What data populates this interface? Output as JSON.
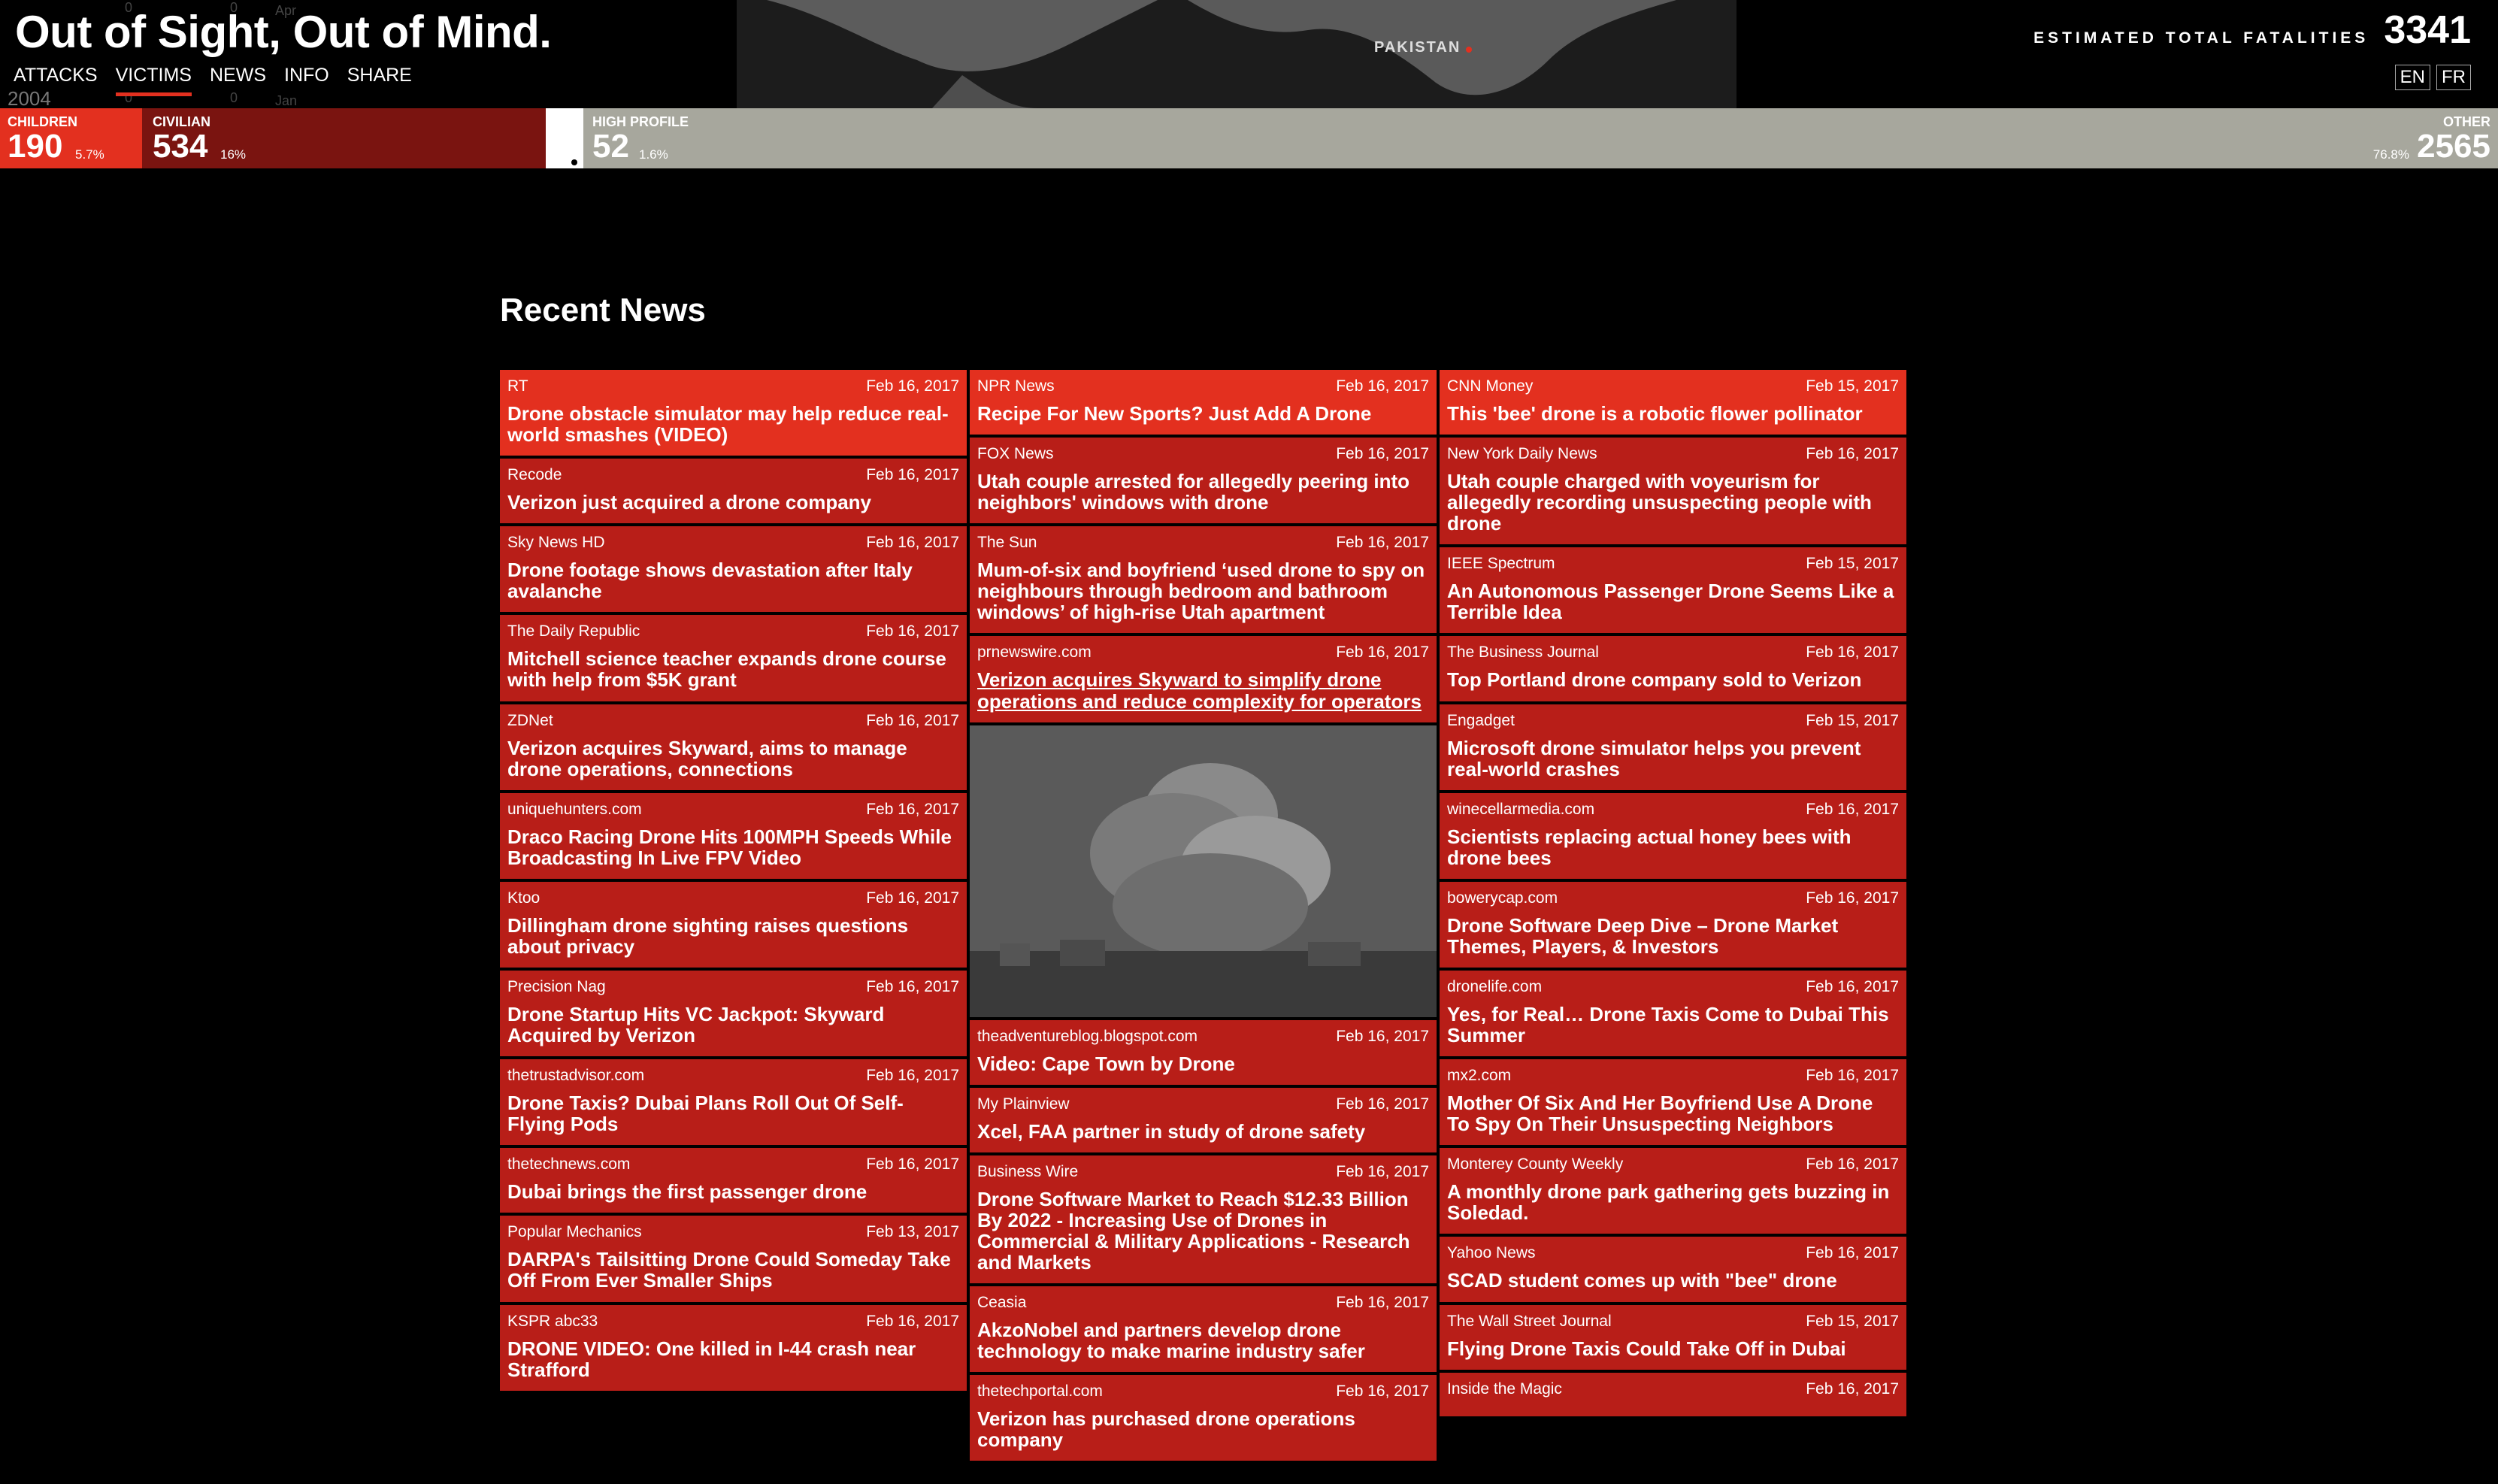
{
  "header": {
    "title": "Out of Sight, Out of Mind.",
    "nav": [
      "ATTACKS",
      "VICTIMS",
      "NEWS",
      "INFO",
      "SHARE"
    ],
    "active_nav": "VICTIMS",
    "map_label": "PAKISTAN",
    "fatalities_label": "ESTIMATED TOTAL FATALITIES",
    "fatalities_value": "3341",
    "languages": [
      "EN",
      "FR"
    ],
    "timeline_year": "2004",
    "timeline_ghost": [
      "0",
      "0",
      "Apr",
      "0",
      "0",
      "Jan"
    ]
  },
  "victims": {
    "children": {
      "label": "CHILDREN",
      "value": "190",
      "pct": "5.7%"
    },
    "civilian": {
      "label": "CIVILIAN",
      "value": "534",
      "pct": "16%"
    },
    "high_profile": {
      "label": "HIGH PROFILE",
      "value": "52",
      "pct": "1.6%"
    },
    "other": {
      "label": "OTHER",
      "value": "2565",
      "pct": "76.8%"
    }
  },
  "news": {
    "title": "Recent News",
    "columns": [
      [
        {
          "source": "RT",
          "date": "Feb 16, 2017",
          "title": "Drone obstacle simulator may help reduce real-world smashes (VIDEO)"
        },
        {
          "source": "Recode",
          "date": "Feb 16, 2017",
          "title": "Verizon just acquired a drone company"
        },
        {
          "source": "Sky News HD",
          "date": "Feb 16, 2017",
          "title": "Drone footage shows devastation after Italy avalanche"
        },
        {
          "source": "The Daily Republic",
          "date": "Feb 16, 2017",
          "title": "Mitchell science teacher expands drone course with help from $5K grant"
        },
        {
          "source": "ZDNet",
          "date": "Feb 16, 2017",
          "title": "Verizon acquires Skyward, aims to manage drone operations, connections"
        },
        {
          "source": "uniquehunters.com",
          "date": "Feb 16, 2017",
          "title": "Draco Racing Drone Hits 100MPH Speeds While Broadcasting In Live FPV Video"
        },
        {
          "source": "Ktoo",
          "date": "Feb 16, 2017",
          "title": "Dillingham drone sighting raises questions about privacy"
        },
        {
          "source": "Precision Nag",
          "date": "Feb 16, 2017",
          "title": "Drone Startup Hits VC Jackpot: Skyward Acquired by Verizon"
        },
        {
          "source": "thetrustadvisor.com",
          "date": "Feb 16, 2017",
          "title": "Drone Taxis? Dubai Plans Roll Out Of Self-Flying Pods"
        },
        {
          "source": "thetechnews.com",
          "date": "Feb 16, 2017",
          "title": "Dubai brings the first passenger drone"
        },
        {
          "source": "Popular Mechanics",
          "date": "Feb 13, 2017",
          "title": "DARPA's Tailsitting Drone Could Someday Take Off From Ever Smaller Ships"
        },
        {
          "source": "KSPR abc33",
          "date": "Feb 16, 2017",
          "title": "DRONE VIDEO: One killed in I-44 crash near Strafford"
        }
      ],
      [
        {
          "source": "NPR News",
          "date": "Feb 16, 2017",
          "title": "Recipe For New Sports? Just Add A Drone"
        },
        {
          "source": "FOX News",
          "date": "Feb 16, 2017",
          "title": "Utah couple arrested for allegedly peering into neighbors' windows with drone"
        },
        {
          "source": "The Sun",
          "date": "Feb 16, 2017",
          "title": "Mum-of-six and boyfriend ‘used drone to spy on neighbours through bedroom and bathroom windows’ of high-rise Utah apartment"
        },
        {
          "source": "prnewswire.com",
          "date": "Feb 16, 2017",
          "title": "Verizon acquires Skyward to simplify drone operations and reduce complexity for operators"
        },
        {
          "source": "theadventureblog.blogspot.com",
          "date": "Feb 16, 2017",
          "title": "Video: Cape Town by Drone"
        },
        {
          "source": "My Plainview",
          "date": "Feb 16, 2017",
          "title": "Xcel, FAA partner in study of drone safety"
        },
        {
          "source": "Business Wire",
          "date": "Feb 16, 2017",
          "title": "Drone Software Market to Reach $12.33 Billion By 2022 - Increasing Use of Drones in Commercial & Military Applications - Research and Markets"
        },
        {
          "source": "Ceasia",
          "date": "Feb 16, 2017",
          "title": "AkzoNobel and partners develop drone technology to make marine industry safer"
        },
        {
          "source": "thetechportal.com",
          "date": "Feb 16, 2017",
          "title": "Verizon has purchased drone operations company"
        }
      ],
      [
        {
          "source": "CNN Money",
          "date": "Feb 15, 2017",
          "title": "This 'bee' drone is a robotic flower pollinator"
        },
        {
          "source": "New York Daily News",
          "date": "Feb 16, 2017",
          "title": "Utah couple charged with voyeurism for allegedly recording unsuspecting people with drone"
        },
        {
          "source": "IEEE Spectrum",
          "date": "Feb 15, 2017",
          "title": "An Autonomous Passenger Drone Seems Like a Terrible Idea"
        },
        {
          "source": "The Business Journal",
          "date": "Feb 16, 2017",
          "title": "Top Portland drone company sold to Verizon"
        },
        {
          "source": "Engadget",
          "date": "Feb 15, 2017",
          "title": "Microsoft drone simulator helps you prevent real-world crashes"
        },
        {
          "source": "winecellarmedia.com",
          "date": "Feb 16, 2017",
          "title": "Scientists replacing actual honey bees with drone bees"
        },
        {
          "source": "bowerycap.com",
          "date": "Feb 16, 2017",
          "title": "Drone Software Deep Dive – Drone Market Themes, Players, & Investors"
        },
        {
          "source": "dronelife.com",
          "date": "Feb 16, 2017",
          "title": "Yes, for Real… Drone Taxis Come to Dubai This Summer"
        },
        {
          "source": "mx2.com",
          "date": "Feb 16, 2017",
          "title": "Mother Of Six And Her Boyfriend Use A Drone To Spy On Their Unsuspecting Neighbors"
        },
        {
          "source": "Monterey County Weekly",
          "date": "Feb 16, 2017",
          "title": "A monthly drone park gathering gets buzzing in Soledad."
        },
        {
          "source": "Yahoo News",
          "date": "Feb 16, 2017",
          "title": "SCAD student comes up with \"bee\" drone"
        },
        {
          "source": "The Wall Street Journal",
          "date": "Feb 15, 2017",
          "title": "Flying Drone Taxis Could Take Off in Dubai"
        },
        {
          "source": "Inside the Magic",
          "date": "Feb 16, 2017",
          "title": ""
        }
      ]
    ]
  }
}
